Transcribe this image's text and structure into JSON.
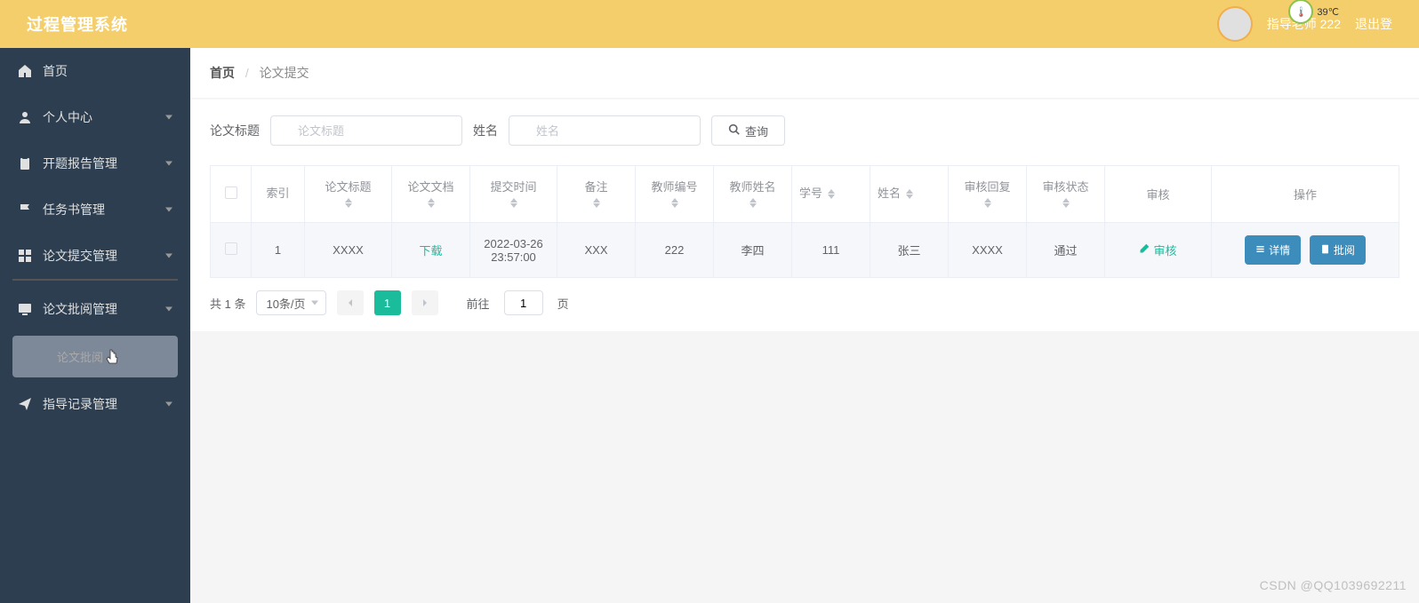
{
  "header": {
    "title": "过程管理系统",
    "user_label": "指导老师 222",
    "logout_label": "退出登",
    "temperature": "39℃"
  },
  "sidebar": {
    "items": [
      {
        "icon": "home-icon",
        "label": "首页",
        "has_children": false
      },
      {
        "icon": "user-icon",
        "label": "个人中心",
        "has_children": true
      },
      {
        "icon": "clipboard-icon",
        "label": "开题报告管理",
        "has_children": true
      },
      {
        "icon": "flag-icon",
        "label": "任务书管理",
        "has_children": true
      },
      {
        "icon": "grid-icon",
        "label": "论文提交管理",
        "has_children": true
      },
      {
        "icon": "monitor-icon",
        "label": "论文批阅管理",
        "has_children": true,
        "expanded": true,
        "children": [
          {
            "label": "论文批阅"
          }
        ]
      },
      {
        "icon": "send-icon",
        "label": "指导记录管理",
        "has_children": true
      }
    ]
  },
  "breadcrumb": {
    "home": "首页",
    "current": "论文提交"
  },
  "filters": {
    "title_label": "论文标题",
    "title_placeholder": "论文标题",
    "name_label": "姓名",
    "name_placeholder": "姓名",
    "query_button": "查询"
  },
  "table": {
    "columns": [
      "",
      "索引",
      "论文标题",
      "论文文档",
      "提交时间",
      "备注",
      "教师编号",
      "教师姓名",
      "学号",
      "姓名",
      "审核回复",
      "审核状态",
      "审核",
      "操作"
    ],
    "rows": [
      {
        "index": "1",
        "title": "XXXX",
        "doc_link": "下载",
        "submit_time": "2022-03-26 23:57:00",
        "remark": "XXX",
        "teacher_id": "222",
        "teacher_name": "李四",
        "student_id": "111",
        "student_name": "张三",
        "review_reply": "XXXX",
        "review_status": "通过",
        "review_action": "审核",
        "op_detail": "详情",
        "op_review": "批阅"
      }
    ]
  },
  "pagination": {
    "total_text": "共 1 条",
    "page_size": "10条/页",
    "current_page": "1",
    "goto_prefix": "前往",
    "goto_value": "1",
    "goto_suffix": "页"
  },
  "watermark": "CSDN @QQ1039692211"
}
